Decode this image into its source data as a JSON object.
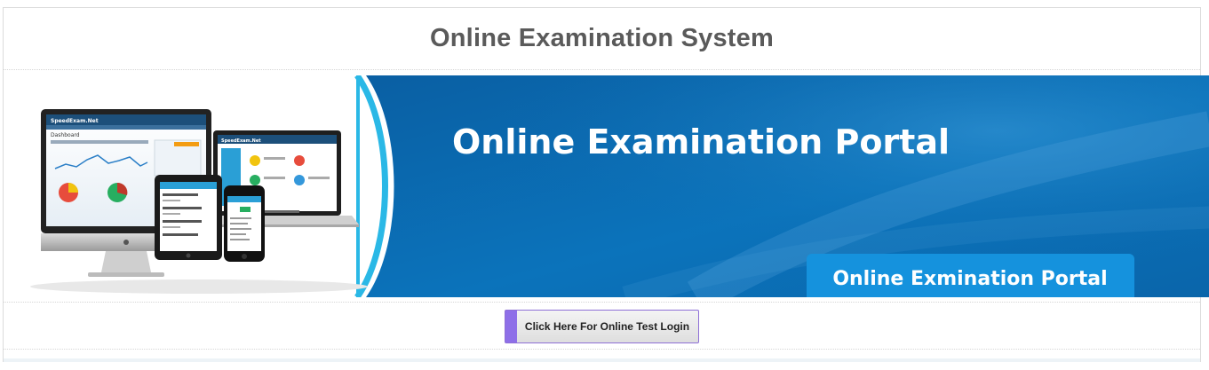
{
  "page": {
    "title": "Online Examination System"
  },
  "banner": {
    "headline": "Online Examination Portal",
    "tag_label": "Online Exmination Portal",
    "brand_blue": "#0b6fb5",
    "tag_blue": "#1592dd",
    "devices": {
      "monitor_brand": "SpeedExam.Net",
      "laptop_brand": "SpeedExam.Net",
      "monitor_panel": "Dashboard"
    }
  },
  "actions": {
    "login_button": "Click Here For Online Test Login"
  },
  "colors": {
    "button_accent": "#8e6fe8",
    "title_text": "#5a5a5a"
  }
}
